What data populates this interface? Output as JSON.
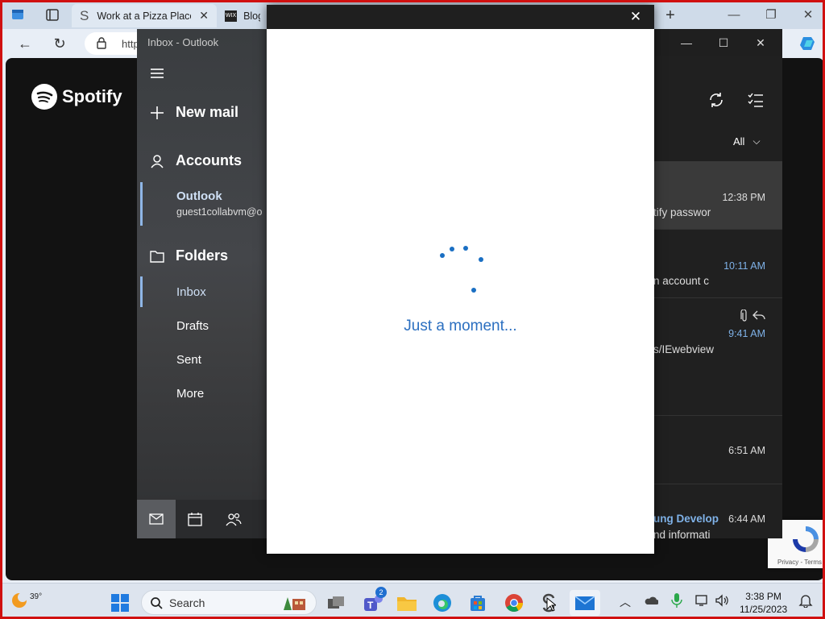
{
  "browser": {
    "tabs": [
      {
        "title": "Work at a Pizza Place",
        "icon": "s-letter-icon"
      },
      {
        "title": "Blog",
        "icon": "wix-icon"
      }
    ],
    "url_prefix": "http",
    "new_tab_label": "+"
  },
  "page": {
    "brand": "Spotify",
    "recaptcha": "Privacy - Terms"
  },
  "mail": {
    "window_title": "Inbox - Outlook",
    "new_mail": "New mail",
    "accounts_label": "Accounts",
    "account_name": "Outlook",
    "account_email": "guest1collabvm@o",
    "folders_label": "Folders",
    "folders": [
      "Inbox",
      "Drafts",
      "Sent",
      "More"
    ],
    "filter": "All",
    "messages": [
      {
        "time": "12:38 PM",
        "snippet": "tify passwor",
        "sender": ""
      },
      {
        "time": "10:11 AM",
        "snippet": "n account c",
        "sender": ""
      },
      {
        "time": "9:41 AM",
        "snippet": "s/IEwebview",
        "sender": ""
      },
      {
        "time": "6:51 AM",
        "snippet": "",
        "sender": ""
      },
      {
        "time": "6:44 AM",
        "snippet": "nd informati",
        "sender": "ung Develop"
      }
    ]
  },
  "dialog": {
    "loading_text": "Just a moment..."
  },
  "taskbar": {
    "weather_temp": "39°",
    "search_label": "Search",
    "teams_badge": "2",
    "time": "3:38 PM",
    "date": "11/25/2023"
  },
  "colors": {
    "accent": "#1a6fc3",
    "outline": "#d01010"
  }
}
